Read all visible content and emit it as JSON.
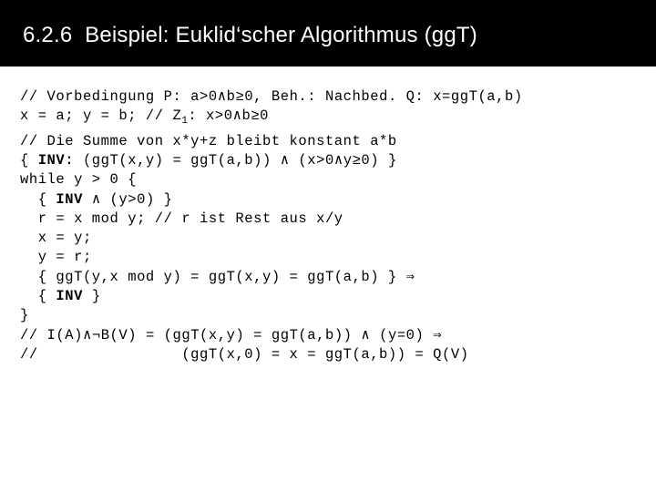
{
  "slide": {
    "title": "6.2.6  Beispiel: Euklid‘scher Algorithmus (ggT)",
    "title_bar_color": "#000000",
    "title_text_color": "#ffffff",
    "background_color": "#ffffff",
    "code_text_color": "#000000"
  },
  "code": {
    "lines": [
      {
        "id": "line-1-vorbedingung",
        "segments": [
          {
            "text": "// Vorbedingung P: a>0∧b≥0, Beh.: Nachbed. Q: x=ggT(a,b)",
            "bold": false
          }
        ]
      },
      {
        "id": "line-2-init",
        "segments": [
          {
            "text": "x = a; y = b; // Z",
            "bold": false
          },
          {
            "text": "1",
            "bold": false,
            "sub": true
          },
          {
            "text": ": x>0∧b≥0",
            "bold": false
          }
        ]
      },
      {
        "id": "line-3-comment-summe",
        "segments": [
          {
            "text": "// Die Summe von x*y+z bleibt konstant a*b",
            "bold": false
          }
        ]
      },
      {
        "id": "line-4-invariant",
        "segments": [
          {
            "text": "{ ",
            "bold": false
          },
          {
            "text": "INV:",
            "bold": true
          },
          {
            "text": " (ggT(x,y) = ggT(a,b)) ∧ (x>0∧y≥0) }",
            "bold": false
          }
        ]
      },
      {
        "id": "line-5-while",
        "segments": [
          {
            "text": "while y > 0 {",
            "bold": false
          }
        ]
      },
      {
        "id": "line-6-inv-and-guard",
        "segments": [
          {
            "text": "  { ",
            "bold": false
          },
          {
            "text": "INV",
            "bold": true
          },
          {
            "text": " ∧ (y>0) }",
            "bold": false
          }
        ]
      },
      {
        "id": "line-7-r-assign",
        "segments": [
          {
            "text": "  r = x mod y; // r ist Rest aus x/y",
            "bold": false
          }
        ]
      },
      {
        "id": "line-8-x-assign",
        "segments": [
          {
            "text": "  x = y;",
            "bold": false
          }
        ]
      },
      {
        "id": "line-9-y-assign",
        "segments": [
          {
            "text": "  y = r;",
            "bold": false
          }
        ]
      },
      {
        "id": "line-10-ggt-chain",
        "segments": [
          {
            "text": "  { ggT(y,x mod y) = ggT(x,y) = ggT(a,b) } ⇒",
            "bold": false
          }
        ]
      },
      {
        "id": "line-11-inv",
        "segments": [
          {
            "text": "  { ",
            "bold": false
          },
          {
            "text": "INV",
            "bold": true
          },
          {
            "text": " }",
            "bold": false
          }
        ]
      },
      {
        "id": "line-12-close-brace",
        "segments": [
          {
            "text": "}",
            "bold": false
          }
        ]
      },
      {
        "id": "line-13-termination",
        "segments": [
          {
            "text": "// I(A)∧¬B(V) = (ggT(x,y) = ggT(a,b)) ∧ (y=0) ⇒",
            "bold": false
          }
        ]
      },
      {
        "id": "line-14-conclusion",
        "segments": [
          {
            "text": "//                (ggT(x,0) = x = ggT(a,b)) = Q(V)",
            "bold": false
          }
        ]
      }
    ]
  }
}
